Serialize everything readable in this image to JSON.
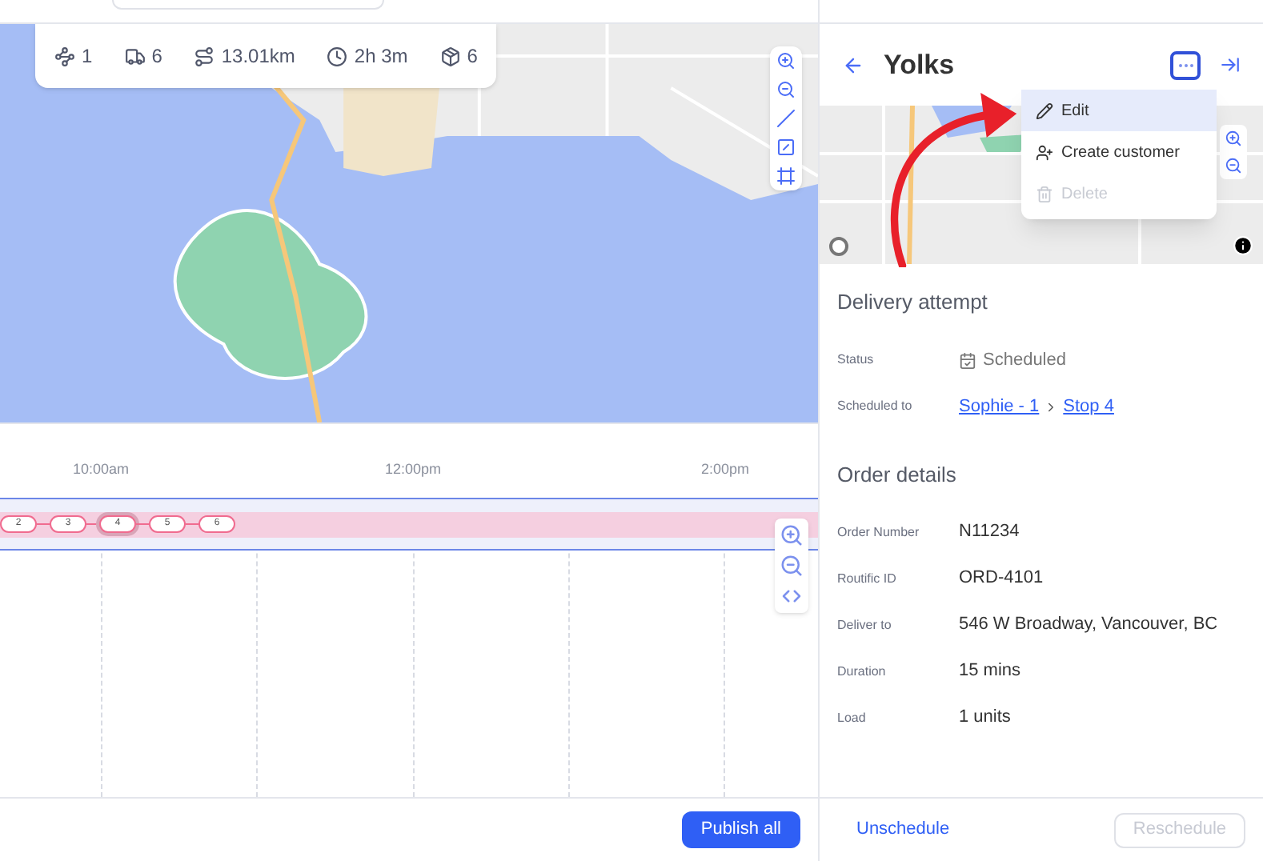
{
  "route_stats": [
    {
      "kind": "routes",
      "value": "1"
    },
    {
      "kind": "stops",
      "value": "6"
    },
    {
      "kind": "distance",
      "value": "13.01km"
    },
    {
      "kind": "time",
      "value": "2h 3m"
    },
    {
      "kind": "load",
      "value": "6"
    }
  ],
  "timeline": {
    "times": [
      "10:00am",
      "12:00pm",
      "2:00pm"
    ],
    "stops": [
      {
        "label": "2",
        "selected": false
      },
      {
        "label": "3",
        "selected": false
      },
      {
        "label": "4",
        "selected": true
      },
      {
        "label": "5",
        "selected": false
      },
      {
        "label": "6",
        "selected": false
      }
    ]
  },
  "footer": {
    "publish_button": "Publish all"
  },
  "detail": {
    "title": "Yolks",
    "menu": [
      {
        "kind": "edit",
        "label": "Edit",
        "selected": true,
        "disabled": false
      },
      {
        "kind": "customer",
        "label": "Create customer",
        "selected": false,
        "disabled": false
      },
      {
        "kind": "delete",
        "label": "Delete",
        "selected": false,
        "disabled": true
      }
    ],
    "sections": [
      {
        "title": "Delivery attempt",
        "rows": [
          {
            "kind": "status",
            "label": "Status",
            "value": "Scheduled"
          },
          {
            "kind": "links",
            "label": "Scheduled to",
            "links": [
              "Sophie - 1",
              "Stop 4"
            ]
          }
        ]
      },
      {
        "title": "Order details",
        "rows": [
          {
            "kind": "text",
            "label": "Order Number",
            "value": "N11234"
          },
          {
            "kind": "text",
            "label": "Routific ID",
            "value": "ORD-4101"
          },
          {
            "kind": "text",
            "label": "Deliver to",
            "value": "546 W Broadway, Vancouver, BC"
          },
          {
            "kind": "text",
            "label": "Duration",
            "value": "15 mins"
          },
          {
            "kind": "text",
            "label": "Load",
            "value": "1 units"
          }
        ]
      }
    ],
    "unschedule_button": "Unschedule",
    "reschedule_button": {
      "label": "Reschedule",
      "disabled": true
    }
  }
}
